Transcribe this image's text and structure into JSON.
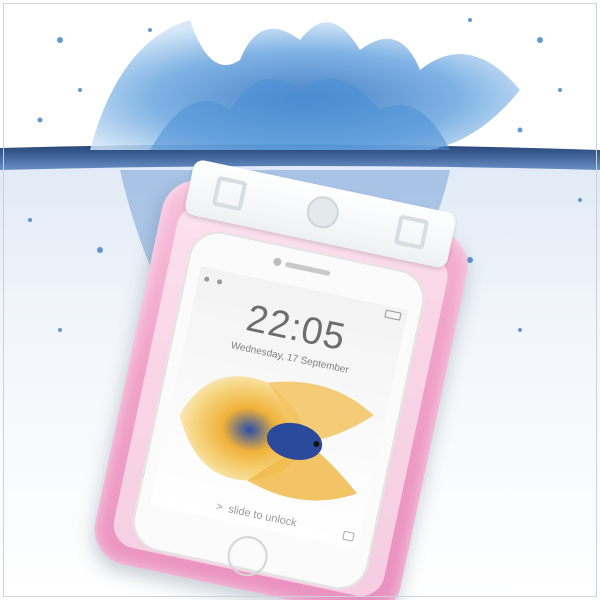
{
  "scene": {
    "subject": "phone-in-waterproof-pouch",
    "pouch_color": "#f1a3c9",
    "water_color": "#3b6fae",
    "background_color": "#ffffff"
  },
  "lockscreen": {
    "time": "22:05",
    "date": "Wednesday, 17 September",
    "slide_text": "slide to unlock",
    "chevron": ">"
  }
}
